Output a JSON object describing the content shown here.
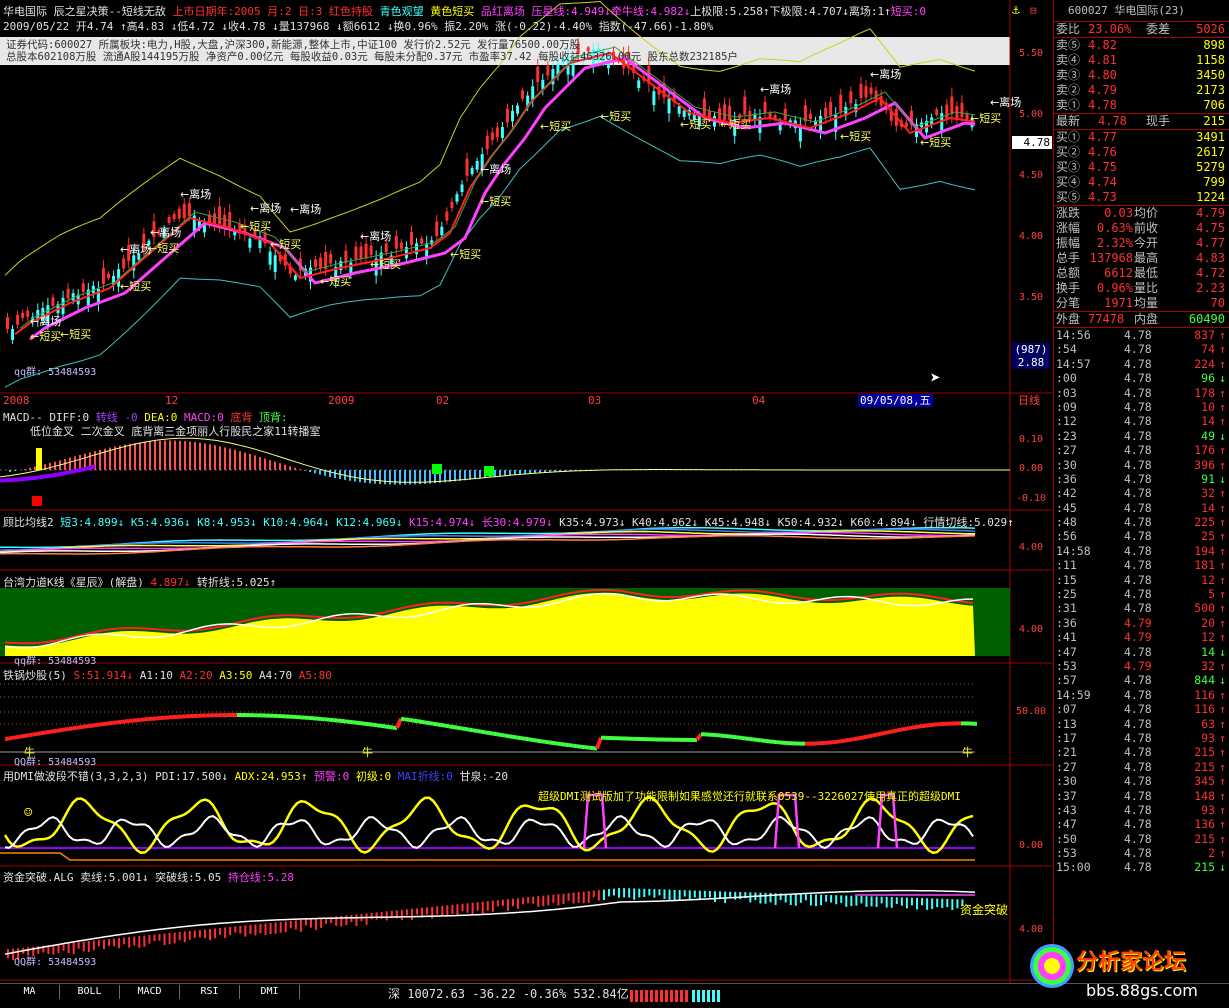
{
  "header": {
    "line1": [
      {
        "t": "华电国际  辰之星决策--短线无敌",
        "c": "w"
      },
      {
        "t": " 上市日期年:2005  月:2  日:3 ",
        "c": "r"
      },
      {
        "t": "红色持股 ",
        "c": "r"
      },
      {
        "t": "青色观望 ",
        "c": "c"
      },
      {
        "t": "黄色短买 ",
        "c": "y"
      },
      {
        "t": "品红离场 ",
        "c": "m"
      },
      {
        "t": "压星线:4.949↓",
        "c": "m"
      },
      {
        "t": "牵牛线:4.982↓",
        "c": "m"
      },
      {
        "t": "上极限:5.258↑",
        "c": "w"
      },
      {
        "t": "下极限:4.707↓",
        "c": "w"
      },
      {
        "t": "离场:1↑",
        "c": "w"
      },
      {
        "t": "短买:0",
        "c": "m"
      }
    ],
    "line2": "2009/05/22  开4.74 ↑高4.83 ↓低4.72 ↓收4.78 ↓量137968 ↓额6612 ↓换0.96% 振2.20%  涨(-0.22)-4.40%  指数(-47.66)-1.80%",
    "info1": "证券代码:600027   所属板块:电力,H股,大盘,沪深300,新能源,整体上市,中证100    发行价2.52元    发行量76500.00万股",
    "info2": "总股本602108万股   流通A股144195万股   净资产0.00亿元   每股收益0.03元   每股未分配0.37元   市盈率37.42  每股收益46326.00元    股东总数232185户",
    "qq": "qq群: 53484593",
    "dates": [
      "2008",
      "12",
      "2009",
      "02",
      "03",
      "04"
    ],
    "current_date": "09/05/08,五",
    "period": "日线"
  },
  "price_axis": [
    "5.50",
    "5.00",
    "4.50",
    "4.00",
    "3.50"
  ],
  "price_marker": "4.78",
  "scale_box": [
    "(987)",
    "2.88"
  ],
  "macd": {
    "title": "MACD--  DIFF:0 ",
    "zx": "转线 -0 ",
    "dea": "DEA:0 ",
    "macd": "MACD:0 ",
    "db": "底背 ",
    "db2": "顶背:",
    "subtitle": " 低位金叉  二次金叉  底背离三金项丽人行股民之家11转播室",
    "axis": [
      "0.10",
      "0.00",
      "-0.10"
    ]
  },
  "gubi": {
    "title": "顾比均线2 ",
    "vals": "短3:4.899↓ K5:4.936↓ K8:4.953↓ K10:4.964↓ K12:4.969↓",
    "k15": " K15:4.974↓ 长30:4.979↓",
    "rest": " K35:4.973↓ K40:4.962↓ K45:4.948↓ K50:4.932↓ K60:4.894↓ 行情切线:5.029↑",
    "axis": [
      "4.00"
    ]
  },
  "tw": {
    "title": "台湾力道K线《星辰》(解盘) ",
    "v1": "4.897↓",
    "v2": " 转折线:5.025↑",
    "qq": "qq群: 53484593",
    "axis": [
      "4.00"
    ]
  },
  "tieguo": {
    "title": "铁锅炒股(5) ",
    "s": "S:51.914↓",
    "a1": " A1:10 ",
    "a2": "A2:20 ",
    "a3": "A3:50 ",
    "a4": "A4:70 ",
    "a5": "A5:80",
    "qq": "QQ群: 53484593",
    "axis": [
      "50.00"
    ],
    "marker": "牛"
  },
  "dmi": {
    "title": "用DMI做波段不错(3,3,2,3) PDI:17.500↓ ",
    "adx": "ADX:24.953↑",
    "yj": " 预警:0",
    "cj": " 初级:0",
    "mai": " MAI折线:0",
    "gm": " 甘泉:-20",
    "banner": "超级DMI测试版加了功能限制如果感觉还行就联系0539--3226027使用真正的超级DMI",
    "axis": [
      "0.00"
    ]
  },
  "zj": {
    "title": "资金突破.ALG ",
    "mx": "卖线:5.001↓",
    "tp": " 突破线:5.05",
    "cc": " 持仓线:5.28",
    "label": "资金突破",
    "qq": "QQ群: 53484593",
    "axis": [
      "4.00"
    ]
  },
  "chart_labels": {
    "short_buy": "短买",
    "exit": "离场"
  },
  "quote": {
    "code": "600027  华电国际(23)",
    "wb": {
      "l": "委比",
      "v": "23.06%",
      "l2": "委差",
      "v2": "5026"
    },
    "sells": [
      {
        "l": "卖⑤",
        "p": "4.82",
        "v": "898"
      },
      {
        "l": "卖④",
        "p": "4.81",
        "v": "1158"
      },
      {
        "l": "卖③",
        "p": "4.80",
        "v": "3450"
      },
      {
        "l": "卖②",
        "p": "4.79",
        "v": "2173"
      },
      {
        "l": "卖①",
        "p": "4.78",
        "v": "706"
      }
    ],
    "last": {
      "l": "最新",
      "p": "4.78",
      "l2": "现手",
      "v": "215"
    },
    "buys": [
      {
        "l": "买①",
        "p": "4.77",
        "v": "3491"
      },
      {
        "l": "买②",
        "p": "4.76",
        "v": "2617"
      },
      {
        "l": "买③",
        "p": "4.75",
        "v": "5279"
      },
      {
        "l": "买④",
        "p": "4.74",
        "v": "799"
      },
      {
        "l": "买⑤",
        "p": "4.73",
        "v": "1224"
      }
    ],
    "stats": [
      {
        "l": "涨跌",
        "v": "0.03",
        "l2": "均价",
        "v2": "4.79"
      },
      {
        "l": "涨幅",
        "v": "0.63%",
        "l2": "前收",
        "v2": "4.75"
      },
      {
        "l": "振幅",
        "v": "2.32%",
        "l2": "今开",
        "v2": "4.77"
      },
      {
        "l": "总手",
        "v": "137968",
        "l2": "最高",
        "v2": "4.83"
      },
      {
        "l": "总额",
        "v": "6612",
        "l2": "最低",
        "v2": "4.72"
      },
      {
        "l": "换手",
        "v": "0.96%",
        "l2": "量比",
        "v2": "2.23"
      },
      {
        "l": "分笔",
        "v": "1971",
        "l2": "均量",
        "v2": "70"
      }
    ],
    "wp": {
      "l": "外盘",
      "v": "77478",
      "l2": "内盘",
      "v2": "60490"
    },
    "ticks": [
      {
        "t": "14:56",
        "p": "4.78",
        "v": "837",
        "a": "↑"
      },
      {
        "t": ":54",
        "p": "4.78",
        "v": "74",
        "a": "↑"
      },
      {
        "t": "14:57",
        "p": "4.78",
        "v": "224",
        "a": "↑"
      },
      {
        "t": ":00",
        "p": "4.78",
        "v": "96",
        "a": "↓"
      },
      {
        "t": ":03",
        "p": "4.78",
        "v": "178",
        "a": "↑"
      },
      {
        "t": ":09",
        "p": "4.78",
        "v": "10",
        "a": "↑"
      },
      {
        "t": ":12",
        "p": "4.78",
        "v": "14",
        "a": "↑"
      },
      {
        "t": ":23",
        "p": "4.78",
        "v": "49",
        "a": "↓"
      },
      {
        "t": ":27",
        "p": "4.78",
        "v": "176",
        "a": "↑"
      },
      {
        "t": ":30",
        "p": "4.78",
        "v": "396",
        "a": "↑"
      },
      {
        "t": ":36",
        "p": "4.78",
        "v": "91",
        "a": "↓"
      },
      {
        "t": ":42",
        "p": "4.78",
        "v": "32",
        "a": "↑"
      },
      {
        "t": ":45",
        "p": "4.78",
        "v": "14",
        "a": "↑"
      },
      {
        "t": ":48",
        "p": "4.78",
        "v": "225",
        "a": "↑"
      },
      {
        "t": ":56",
        "p": "4.78",
        "v": "25",
        "a": "↑"
      },
      {
        "t": "14:58",
        "p": "4.78",
        "v": "194",
        "a": "↑"
      },
      {
        "t": ":11",
        "p": "4.78",
        "v": "181",
        "a": "↑"
      },
      {
        "t": ":15",
        "p": "4.78",
        "v": "12",
        "a": "↑"
      },
      {
        "t": ":25",
        "p": "4.78",
        "v": "5",
        "a": "↑"
      },
      {
        "t": ":31",
        "p": "4.78",
        "v": "500",
        "a": "↑"
      },
      {
        "t": ":36",
        "p": "4.79",
        "v": "20",
        "a": "↑"
      },
      {
        "t": ":41",
        "p": "4.79",
        "v": "12",
        "a": "↑"
      },
      {
        "t": ":47",
        "p": "4.78",
        "v": "14",
        "a": "↓"
      },
      {
        "t": ":53",
        "p": "4.79",
        "v": "32",
        "a": "↑"
      },
      {
        "t": ":57",
        "p": "4.78",
        "v": "844",
        "a": "↓"
      },
      {
        "t": "14:59",
        "p": "4.78",
        "v": "116",
        "a": "↑"
      },
      {
        "t": ":07",
        "p": "4.78",
        "v": "116",
        "a": "↑"
      },
      {
        "t": ":13",
        "p": "4.78",
        "v": "63",
        "a": "↑"
      },
      {
        "t": ":17",
        "p": "4.78",
        "v": "93",
        "a": "↑"
      },
      {
        "t": ":21",
        "p": "4.78",
        "v": "215",
        "a": "↑"
      },
      {
        "t": ":27",
        "p": "4.78",
        "v": "215",
        "a": "↑"
      },
      {
        "t": ":30",
        "p": "4.78",
        "v": "345",
        "a": "↑"
      },
      {
        "t": ":37",
        "p": "4.78",
        "v": "148",
        "a": "↑"
      },
      {
        "t": ":43",
        "p": "4.78",
        "v": "93",
        "a": "↑"
      },
      {
        "t": ":47",
        "p": "4.78",
        "v": "136",
        "a": "↑"
      },
      {
        "t": ":50",
        "p": "4.78",
        "v": "215",
        "a": "↑"
      },
      {
        "t": ":53",
        "p": "4.78",
        "v": "2",
        "a": "↑"
      },
      {
        "t": "15:00",
        "p": "4.78",
        "v": "215",
        "a": "↓"
      }
    ]
  },
  "tabs": [
    "MA",
    "BOLL",
    "MACD",
    "RSI",
    "DMI"
  ],
  "status": {
    "text": "深 10072.63  -36.22 -0.36% 532.84亿",
    "logo": "分析家论坛",
    "url": "bbs.88gs.com"
  },
  "colors": {
    "up": "#ff3030",
    "down": "#40ffff",
    "axis": "#a00000",
    "bg": "#000000"
  }
}
